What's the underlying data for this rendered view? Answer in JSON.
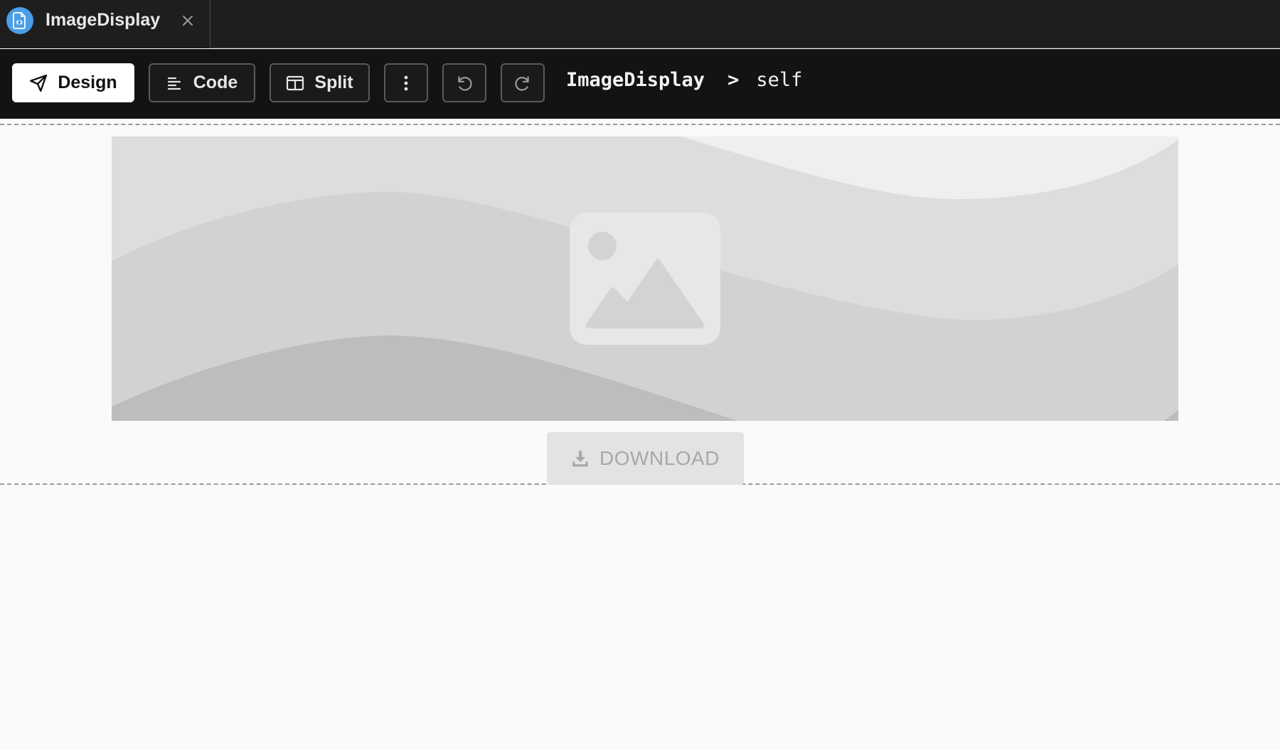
{
  "tab": {
    "title": "ImageDisplay",
    "icon": "code-file-icon",
    "close_icon": "close-icon"
  },
  "toolbar": {
    "design_label": "Design",
    "code_label": "Code",
    "split_label": "Split",
    "active_mode": "Design",
    "more_icon": "more-vertical-icon",
    "undo_icon": "undo-icon",
    "redo_icon": "redo-icon"
  },
  "breadcrumb": {
    "root": "ImageDisplay",
    "separator": ">",
    "leaf": "self"
  },
  "preview": {
    "image_icon": "image-placeholder-icon",
    "download_label": "DOWNLOAD",
    "download_icon": "download-icon",
    "download_disabled": true
  },
  "colors": {
    "tab_bg": "#1e1e1e",
    "toolbar_bg": "#131313",
    "accent_icon": "#4a9ee6",
    "canvas_bg": "#fafafa"
  }
}
